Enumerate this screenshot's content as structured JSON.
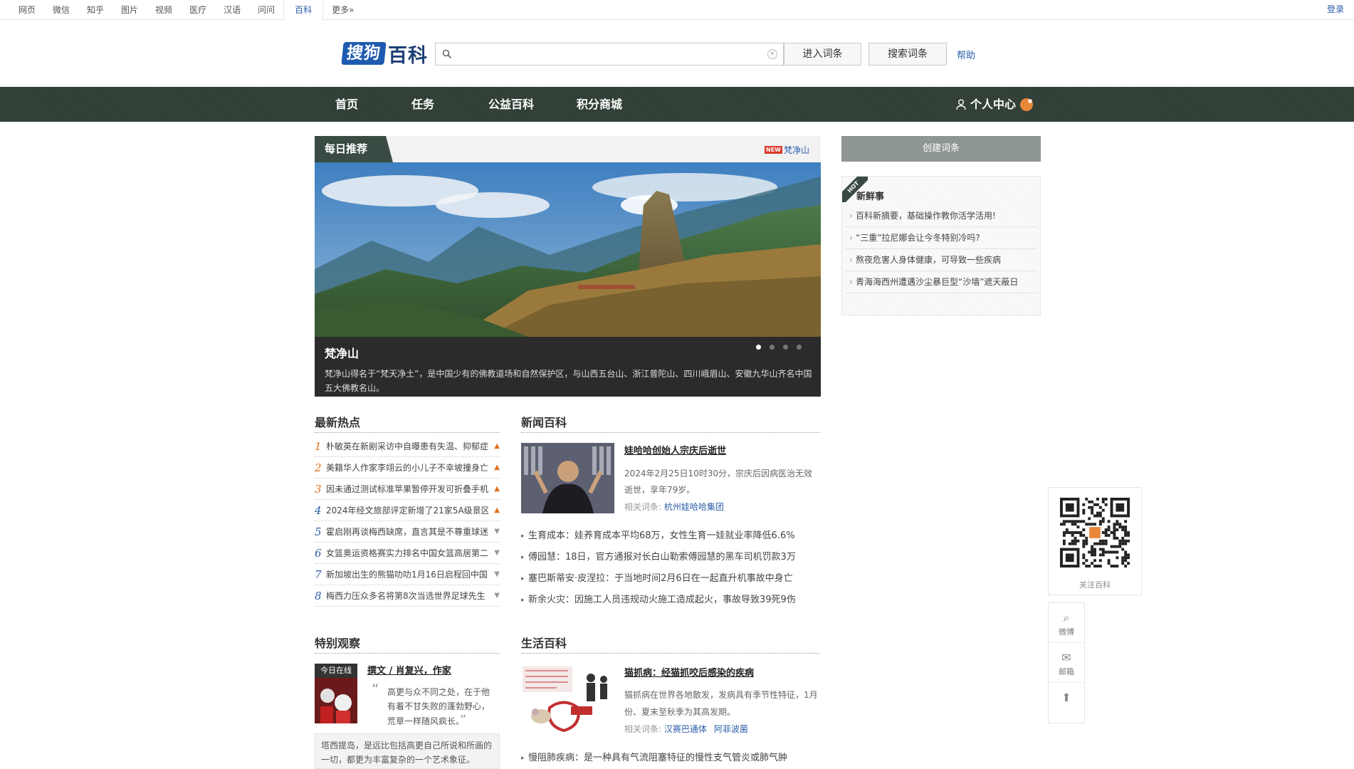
{
  "topnav": {
    "links": [
      "网页",
      "微信",
      "知乎",
      "图片",
      "视频",
      "医疗",
      "汉语",
      "问问",
      "百科",
      "更多»"
    ],
    "active_index": 8,
    "login": "登录"
  },
  "header": {
    "logo_box": "搜狗",
    "logo_text": "百科",
    "search_value": "",
    "enter_label": "进入词条",
    "search_label": "搜索词条",
    "help": "帮助"
  },
  "mainnav": {
    "items": [
      "首页",
      "任务",
      "公益百科",
      "积分商城"
    ],
    "user_center": "个人中心"
  },
  "daily": {
    "tag": "每日推荐",
    "new_badge": "NEW",
    "new_link": "梵净山",
    "title": "梵净山",
    "desc": "梵净山得名于“梵天净土”，是中国少有的佛教道场和自然保护区，与山西五台山、浙江普陀山、四川峨眉山、安徽九华山齐名中国五大佛教名山。",
    "slides": 4,
    "active_slide": 0
  },
  "right": {
    "create_label": "创建词条",
    "hot_badge": "HOT",
    "fresh_title": "新鲜事",
    "fresh_items": [
      "百科新摘要，基础操作教你活学活用!",
      "“三重”拉尼娜会让今冬特别冷吗?",
      "熬夜危害人身体健康，可导致一些疾病",
      "青海海西州遭遇沙尘暴巨型“沙墙”遮天蔽日"
    ]
  },
  "hot": {
    "title": "最新热点",
    "items": [
      {
        "num": "1",
        "text": "朴敏英在新剧采访中自曝患有失温、抑郁症",
        "trend": "up"
      },
      {
        "num": "2",
        "text": "美籍华人作家李翊云的小儿子不幸坡撞身亡",
        "trend": "up"
      },
      {
        "num": "3",
        "text": "因未通过测试标准苹果暂停开发可折叠手机",
        "trend": "up"
      },
      {
        "num": "4",
        "text": "2024年经文旅部评定新增了21家5A级景区",
        "trend": "up"
      },
      {
        "num": "5",
        "text": "霍启刚再谈梅西缺席，直言其是不尊重球迷",
        "trend": "down"
      },
      {
        "num": "6",
        "text": "女篮奥运资格赛实力排名中国女篮高居第二",
        "trend": "down"
      },
      {
        "num": "7",
        "text": "新加坡出生的熊猫叻叻1月16日启程回中国",
        "trend": "down"
      },
      {
        "num": "8",
        "text": "梅西力压众多名将第8次当选世界足球先生",
        "trend": "down"
      }
    ]
  },
  "news": {
    "title": "新闻百科",
    "headline": "娃哈哈创始人宗庆后逝世",
    "desc": "2024年2月25日10时30分，宗庆后因病医治无效逝世，享年79岁。",
    "related_label": "相关词条:",
    "related": [
      "杭州娃哈哈集团"
    ],
    "items": [
      "生育成本：娃养育成本平均68万，女性生育一娃就业率降低6.6%",
      "傅园慧：18日，官方通报对长白山勒索傅园慧的黑车司机罚款3万",
      "塞巴斯蒂安·皮涅拉：于当地时间2月6日在一起直升机事故中身亡",
      "新余火灾：因施工人员违规动火施工造成起火，事故导致39死9伤"
    ]
  },
  "special": {
    "title": "特别观察",
    "badge": "今日在线",
    "headline": "撰文 / 肖复兴，作家",
    "quote": "高更与众不同之处，在于他有着不甘失败的蓬勃野心，荒草一样随风疯长。",
    "desc": "塔西提岛，是远比包括高更自己所说和所画的一切，都更为丰富复杂的一个艺术象征。"
  },
  "life": {
    "title": "生活百科",
    "headline": "猫抓病：经猫抓咬后感染的疾病",
    "desc": "猫抓病在世界各地散发，发病具有季节性特征，1月份、夏末至秋季为其高发期。",
    "related_label": "相关词条:",
    "related": [
      "汉赛巴通体",
      "阿菲波菌"
    ],
    "items": [
      "慢阻肺疾病：是一种具有气流阻塞特征的慢性支气管炎或肺气肿"
    ]
  },
  "floating": {
    "qr_label": "关注百科",
    "weibo": "微博",
    "mail": "邮箱"
  },
  "colors": {
    "nav_dark": "#2f3d35",
    "link_blue": "#2a5ca8",
    "trend_up": "#e07020"
  }
}
